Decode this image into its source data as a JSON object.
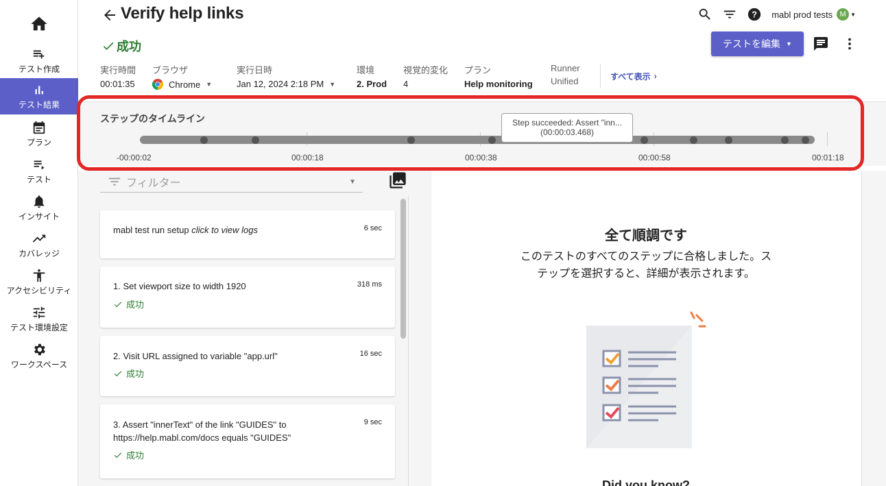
{
  "sidebar": {
    "items": [
      {
        "label": "",
        "icon": "home-icon"
      },
      {
        "label": "テスト作成",
        "icon": "playlist-add-icon"
      },
      {
        "label": "テスト結果",
        "icon": "bar-chart-icon",
        "active": true
      },
      {
        "label": "プラン",
        "icon": "calendar-icon"
      },
      {
        "label": "テスト",
        "icon": "test-list-icon"
      },
      {
        "label": "インサイト",
        "icon": "bell-icon"
      },
      {
        "label": "カバレッジ",
        "icon": "trending-up-icon"
      },
      {
        "label": "アクセシビリティ",
        "icon": "accessibility-icon"
      },
      {
        "label": "テスト環境設定",
        "icon": "tune-icon"
      },
      {
        "label": "ワークスペース",
        "icon": "gear-icon"
      }
    ]
  },
  "header": {
    "title": "Verify help links",
    "status": "成功",
    "workspace": "mabl prod tests",
    "avatar_letter": "M",
    "edit_button": "テストを編集",
    "show_all": "すべて表示"
  },
  "meta": [
    {
      "label": "実行時間",
      "value": "00:01:35"
    },
    {
      "label": "ブラウザ",
      "value": "Chrome"
    },
    {
      "label": "実行日時",
      "value": "Jan 12, 2024 2:18 PM"
    },
    {
      "label": "環境",
      "value": "2. Prod"
    },
    {
      "label": "視覚的変化",
      "value": "4"
    },
    {
      "label": "プラン",
      "value": "Help monitoring"
    },
    {
      "label": "Runner",
      "value": "Unified"
    }
  ],
  "timeline": {
    "title": "ステップのタイムライン",
    "ticks": [
      "-00:00:02",
      "00:00:18",
      "00:00:38",
      "00:00:58",
      "00:01:18"
    ],
    "tooltip_line1": "Step succeeded: Assert \"inn...",
    "tooltip_line2": "(00:00:03.468)"
  },
  "filter": {
    "placeholder": "フィルター"
  },
  "steps": [
    {
      "title": "mabl test run setup",
      "title_em": "click to view logs",
      "time": "6 sec",
      "status": ""
    },
    {
      "title": "1. Set viewport size to width 1920",
      "title_em": "",
      "time": "318 ms",
      "status": "成功"
    },
    {
      "title": "2. Visit URL assigned to variable \"app.url\"",
      "title_em": "",
      "time": "16 sec",
      "status": "成功"
    },
    {
      "title": "3. Assert \"innerText\" of the link \"GUIDES\" to https://help.mabl.com/docs equals \"GUIDES\"",
      "title_em": "",
      "time": "9 sec",
      "status": "成功"
    }
  ],
  "detail": {
    "title": "全て順調です",
    "description": "このテストのすべてのステップに合格しました。ステップを選択すると、詳細が表示されます。",
    "cut_off_text": "Did you know?"
  },
  "colors": {
    "accent": "#5b5fc7",
    "success": "#2e7d32",
    "highlight": "#e32626"
  }
}
